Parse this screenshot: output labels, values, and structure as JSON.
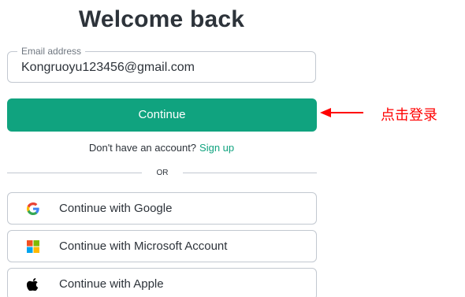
{
  "heading": "Welcome back",
  "email": {
    "label": "Email address",
    "value": "Kongruoyu123456@gmail.com"
  },
  "continue_label": "Continue",
  "annotation": {
    "text": "点击登录",
    "color": "#ff0000"
  },
  "signup": {
    "prompt": "Don't have an account?",
    "link": "Sign up"
  },
  "divider_text": "OR",
  "social_buttons": [
    {
      "label": "Continue with Google",
      "icon": "google-icon"
    },
    {
      "label": "Continue with Microsoft Account",
      "icon": "microsoft-icon"
    },
    {
      "label": "Continue with Apple",
      "icon": "apple-icon"
    }
  ],
  "colors": {
    "accent": "#10a37f",
    "border": "#c2c8d0",
    "text": "#2d333a",
    "annotation": "#ff0000"
  }
}
